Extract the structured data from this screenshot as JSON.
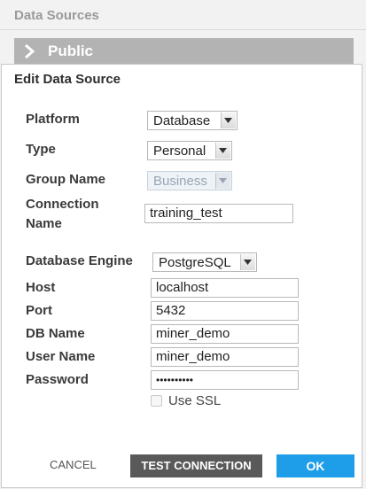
{
  "background": {
    "title": "Data Sources",
    "group_label": "Public",
    "group_icon": "chevron-right-icon"
  },
  "dialog": {
    "title": "Edit Data Source",
    "fields": {
      "platform": {
        "label": "Platform",
        "value": "Database"
      },
      "type": {
        "label": "Type",
        "value": "Personal"
      },
      "group_name": {
        "label": "Group Name",
        "value": "Business",
        "disabled": true
      },
      "connection_name": {
        "label_line1": "Connection",
        "label_line2": "Name",
        "value": "training_test"
      },
      "database_engine": {
        "label": "Database Engine",
        "value": "PostgreSQL"
      },
      "host": {
        "label": "Host",
        "value": "localhost"
      },
      "port": {
        "label": "Port",
        "value": "5432"
      },
      "db_name": {
        "label": "DB Name",
        "value": "miner_demo"
      },
      "user_name": {
        "label": "User Name",
        "value": "miner_demo"
      },
      "password": {
        "label": "Password",
        "value": "••••••••••"
      }
    },
    "use_ssl": {
      "label": "Use SSL",
      "checked": false
    },
    "buttons": {
      "cancel": "CANCEL",
      "test_connection": "TEST CONNECTION",
      "ok": "OK"
    }
  },
  "colors": {
    "primary_button": "#1e9de8",
    "secondary_button": "#595959",
    "group_header": "#b3b3b3"
  }
}
